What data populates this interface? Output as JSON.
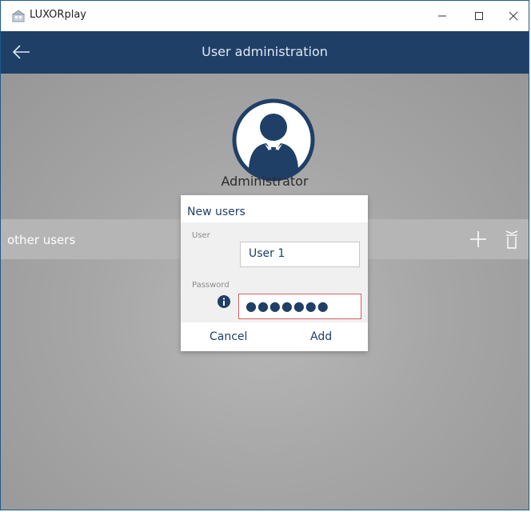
{
  "window": {
    "title": "LUXORplay",
    "minimize_glyph": "—",
    "maximize_glyph": "☐",
    "close_glyph": "✕"
  },
  "header": {
    "title": "User administration",
    "back_icon": "back-arrow-icon"
  },
  "admin": {
    "label": "Administrator",
    "avatar_icon": "administrator-avatar-icon"
  },
  "users_bar": {
    "label": "other users",
    "add_icon": "plus-icon",
    "delete_icon": "trash-icon"
  },
  "dialog": {
    "title": "New users",
    "user_label": "User",
    "user_value": "User 1",
    "password_label": "Password",
    "password_value": "●●●●●●●",
    "info_icon": "info-icon",
    "cancel_label": "Cancel",
    "add_label": "Add"
  },
  "colors": {
    "header": "#1f3f67",
    "accent": "#1f3f67",
    "error_border": "#d46060"
  }
}
